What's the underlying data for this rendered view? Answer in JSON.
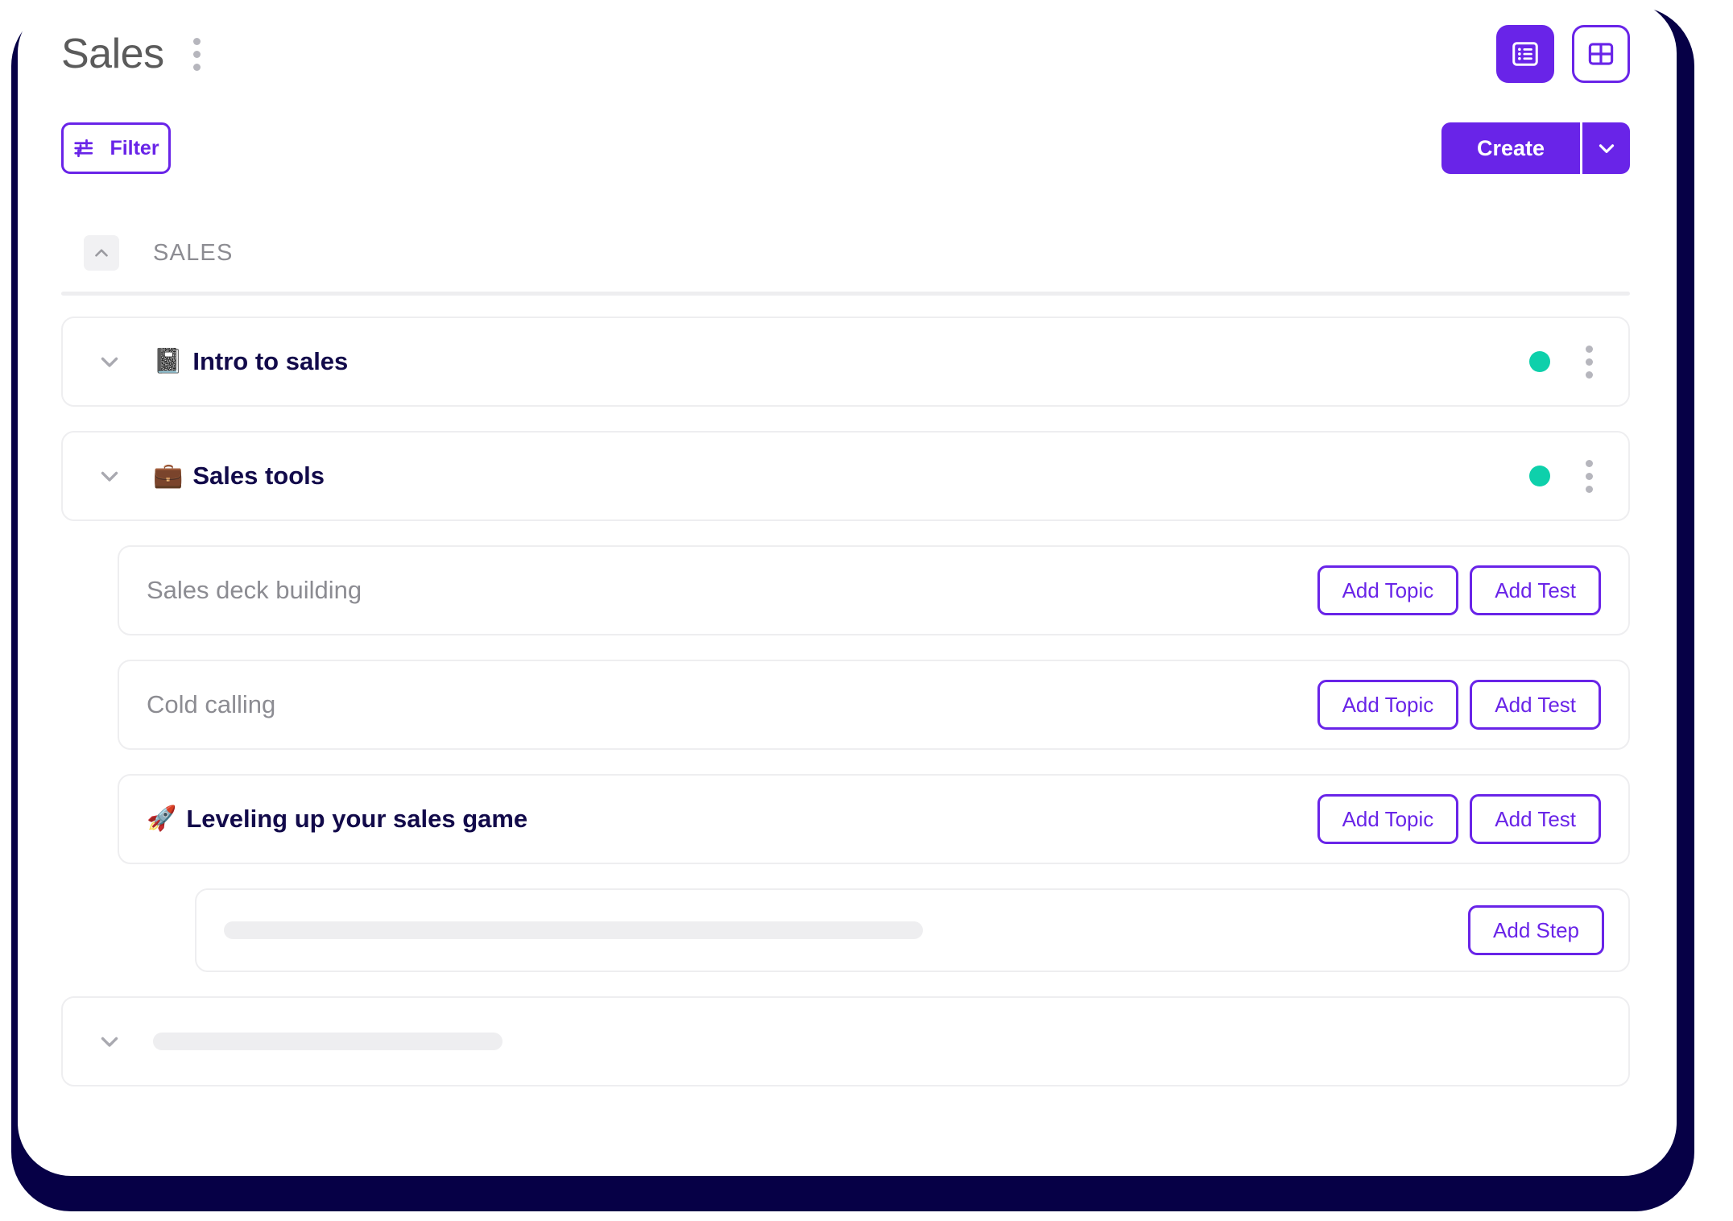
{
  "header": {
    "title": "Sales",
    "kebab_icon": "more-vertical-icon",
    "view_toggle": {
      "list_view_icon": "list-view-icon",
      "list_view_active": true,
      "grid_view_icon": "grid-view-icon",
      "grid_view_active": false
    }
  },
  "toolbar": {
    "filter_label": "Filter",
    "filter_icon": "tune-sliders-icon",
    "create_label": "Create",
    "create_caret_icon": "chevron-down-icon"
  },
  "section": {
    "label": "SALES",
    "collapse_icon": "chevron-up-icon",
    "expanded": true
  },
  "modules": [
    {
      "chevron_icon": "chevron-down-icon",
      "emoji": "📓",
      "title": "Intro to sales",
      "status_color": "#0ED0AB",
      "menu_icon": "more-vertical-icon"
    },
    {
      "chevron_icon": "chevron-down-icon",
      "emoji": "💼",
      "title": "Sales tools",
      "status_color": "#0ED0AB",
      "menu_icon": "more-vertical-icon"
    }
  ],
  "topics": [
    {
      "emoji": "",
      "title": "Sales deck building",
      "muted": true,
      "add_topic_label": "Add Topic",
      "add_test_label": "Add Test"
    },
    {
      "emoji": "",
      "title": "Cold calling",
      "muted": true,
      "add_topic_label": "Add Topic",
      "add_test_label": "Add Test"
    },
    {
      "emoji": "🚀",
      "title": "Leveling up your sales game",
      "muted": false,
      "add_topic_label": "Add Topic",
      "add_test_label": "Add Test"
    }
  ],
  "step_row": {
    "placeholder_bar": "",
    "add_step_label": "Add Step"
  },
  "bottom_row": {
    "chevron_icon": "chevron-down-icon",
    "placeholder_bar": ""
  },
  "colors": {
    "accent_purple": "#6924E8",
    "status_green": "#0ED0AB",
    "title_navy": "#120A4A",
    "backplate_navy": "#060046",
    "muted_gray": "#8C8C92",
    "skeleton_gray": "#EEEEF0"
  }
}
